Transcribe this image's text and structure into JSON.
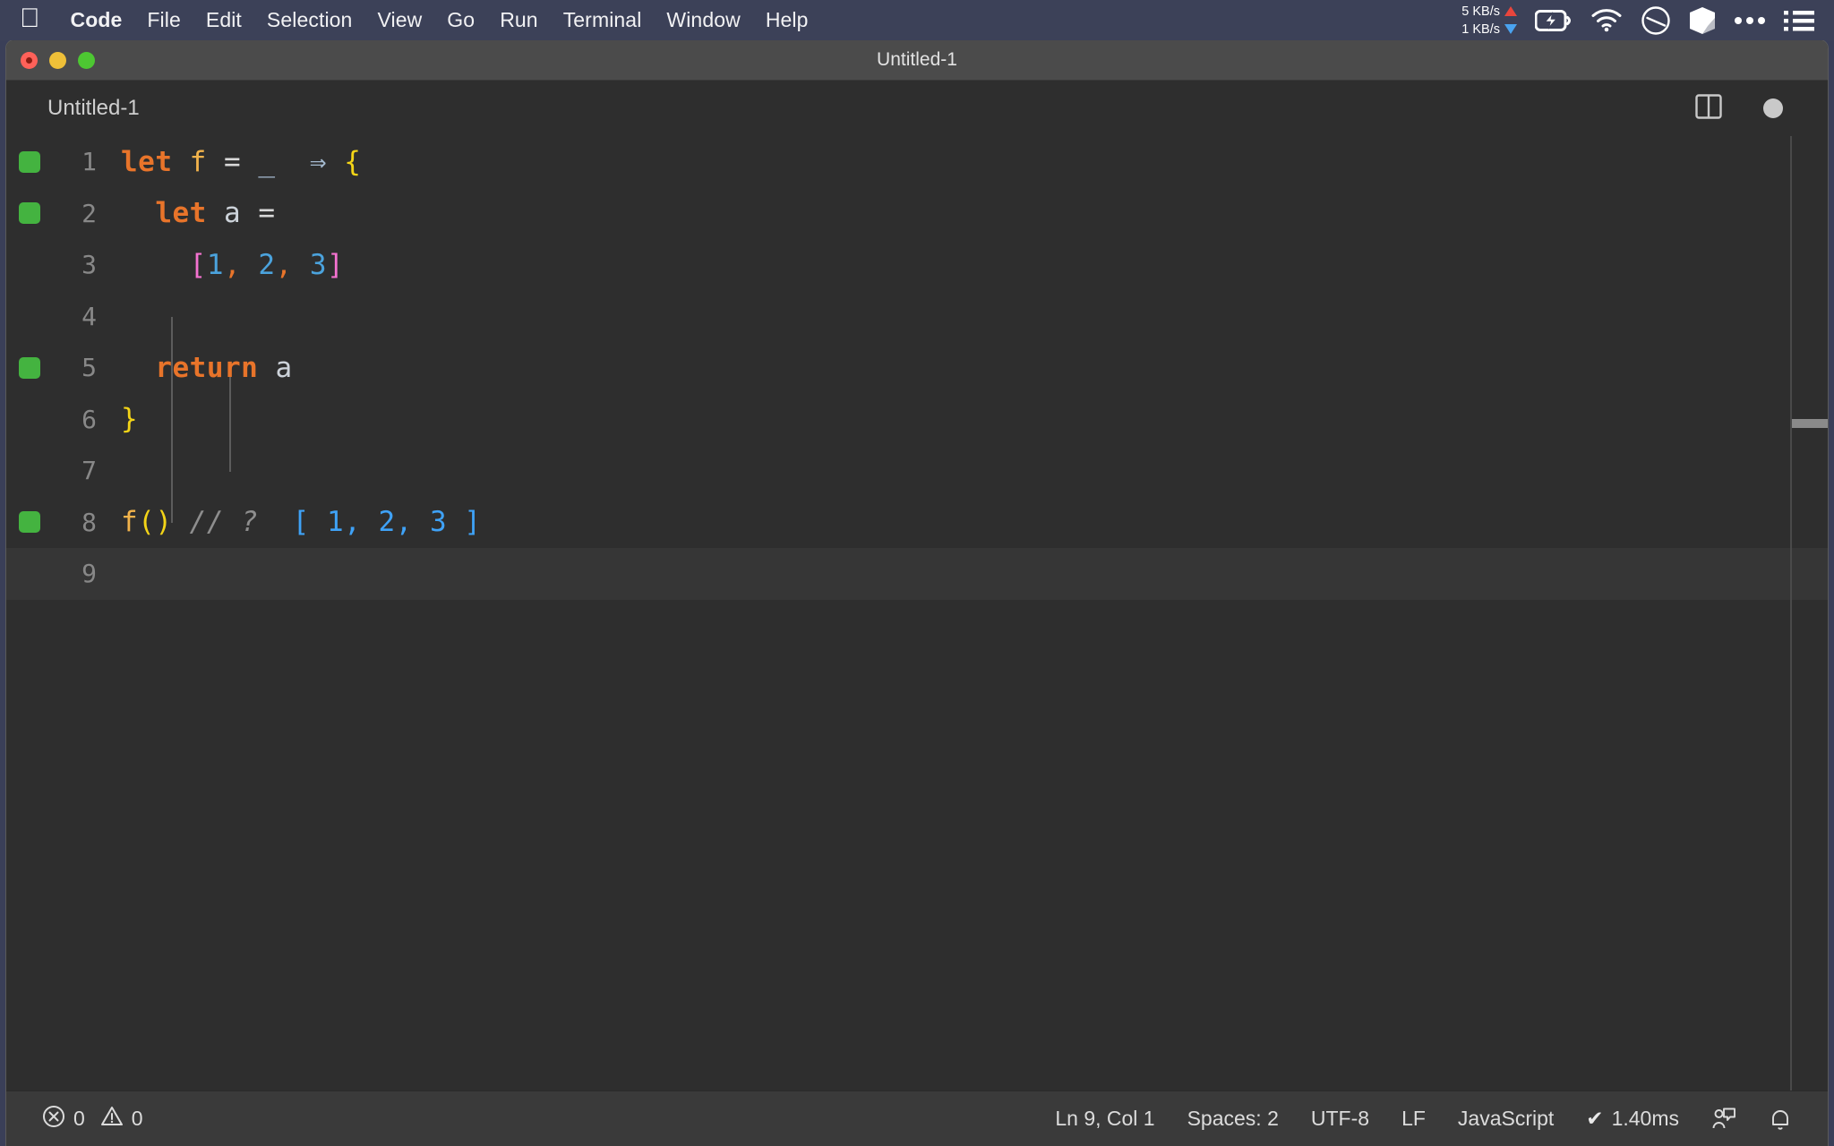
{
  "menubar": {
    "apple_icon": "apple-logo-icon",
    "items": [
      {
        "label": "Code",
        "bold": true
      },
      {
        "label": "File",
        "bold": false
      },
      {
        "label": "Edit",
        "bold": false
      },
      {
        "label": "Selection",
        "bold": false
      },
      {
        "label": "View",
        "bold": false
      },
      {
        "label": "Go",
        "bold": false
      },
      {
        "label": "Run",
        "bold": false
      },
      {
        "label": "Terminal",
        "bold": false
      },
      {
        "label": "Window",
        "bold": false
      },
      {
        "label": "Help",
        "bold": false
      }
    ],
    "tray": {
      "upload_speed": "5 KB/s",
      "download_speed": "1 KB/s",
      "icons": [
        "battery-charging-icon",
        "wifi-icon",
        "do-not-disturb-icon",
        "box-3d-icon",
        "ellipsis-icon",
        "list-menu-icon"
      ]
    }
  },
  "window": {
    "title": "Untitled-1",
    "traffic_lights": [
      "close",
      "minimize",
      "zoom"
    ]
  },
  "tabbar": {
    "tab_label": "Untitled-1",
    "split_editor_icon": "split-editor-icon",
    "dirty_indicator": "unsaved-dot-icon"
  },
  "editor": {
    "language": "JavaScript",
    "lines": [
      {
        "number": "1",
        "marker": true,
        "current": false,
        "tokens": [
          {
            "t": "let",
            "c": "kw"
          },
          {
            "t": " ",
            "c": "op"
          },
          {
            "t": "f",
            "c": "fn"
          },
          {
            "t": " ",
            "c": "op"
          },
          {
            "t": "=",
            "c": "op"
          },
          {
            "t": " ",
            "c": "op"
          },
          {
            "t": "_",
            "c": "arrow"
          },
          {
            "t": "  ",
            "c": "op"
          },
          {
            "t": "⇒",
            "c": "arrow"
          },
          {
            "t": " ",
            "c": "op"
          },
          {
            "t": "{",
            "c": "brace"
          }
        ]
      },
      {
        "number": "2",
        "marker": true,
        "current": false,
        "tokens": [
          {
            "t": "  ",
            "c": "op"
          },
          {
            "t": "let",
            "c": "kw"
          },
          {
            "t": " ",
            "c": "op"
          },
          {
            "t": "a",
            "c": "ident"
          },
          {
            "t": " ",
            "c": "op"
          },
          {
            "t": "=",
            "c": "op"
          }
        ]
      },
      {
        "number": "3",
        "marker": false,
        "current": false,
        "tokens": [
          {
            "t": "    ",
            "c": "op"
          },
          {
            "t": "[",
            "c": "bracket"
          },
          {
            "t": "1",
            "c": "num"
          },
          {
            "t": ",",
            "c": "comma"
          },
          {
            "t": " ",
            "c": "op"
          },
          {
            "t": "2",
            "c": "num"
          },
          {
            "t": ",",
            "c": "comma"
          },
          {
            "t": " ",
            "c": "op"
          },
          {
            "t": "3",
            "c": "num"
          },
          {
            "t": "]",
            "c": "bracket"
          }
        ]
      },
      {
        "number": "4",
        "marker": false,
        "current": false,
        "tokens": []
      },
      {
        "number": "5",
        "marker": true,
        "current": false,
        "tokens": [
          {
            "t": "  ",
            "c": "op"
          },
          {
            "t": "return",
            "c": "kw"
          },
          {
            "t": " ",
            "c": "op"
          },
          {
            "t": "a",
            "c": "ident"
          }
        ]
      },
      {
        "number": "6",
        "marker": false,
        "current": false,
        "tokens": [
          {
            "t": "}",
            "c": "brace"
          }
        ]
      },
      {
        "number": "7",
        "marker": false,
        "current": false,
        "tokens": []
      },
      {
        "number": "8",
        "marker": true,
        "current": false,
        "tokens": [
          {
            "t": "f",
            "c": "fn"
          },
          {
            "t": "()",
            "c": "brace"
          },
          {
            "t": " ",
            "c": "op"
          },
          {
            "t": "// ?",
            "c": "comment"
          },
          {
            "t": "  ",
            "c": "op"
          },
          {
            "t": "[ 1, 2, 3 ]",
            "c": "result"
          }
        ]
      },
      {
        "number": "9",
        "marker": false,
        "current": true,
        "tokens": []
      }
    ]
  },
  "statusbar": {
    "errors_icon": "error-circle-icon",
    "errors_count": "0",
    "warnings_icon": "warning-triangle-icon",
    "warnings_count": "0",
    "cursor_position": "Ln 9, Col 1",
    "indentation": "Spaces: 2",
    "encoding": "UTF-8",
    "eol": "LF",
    "language_mode": "JavaScript",
    "run_time": "1.40ms",
    "run_time_icon": "check-mark-icon",
    "remote_icon": "live-share-icon",
    "notifications_icon": "bell-icon"
  },
  "colors": {
    "menubar_bg": "#3c4158",
    "titlebar_bg": "#4b4b4b",
    "editor_bg": "#2e2e2e",
    "statusbar_bg": "#3a3a3a",
    "marker_green": "#44b340",
    "keyword_orange": "#e8742a",
    "brace_yellow": "#f3d417",
    "bracket_pink": "#f472d0",
    "number_blue": "#4ba3dd",
    "result_blue": "#3fa2f7",
    "comment_gray": "#8e8e8e"
  }
}
